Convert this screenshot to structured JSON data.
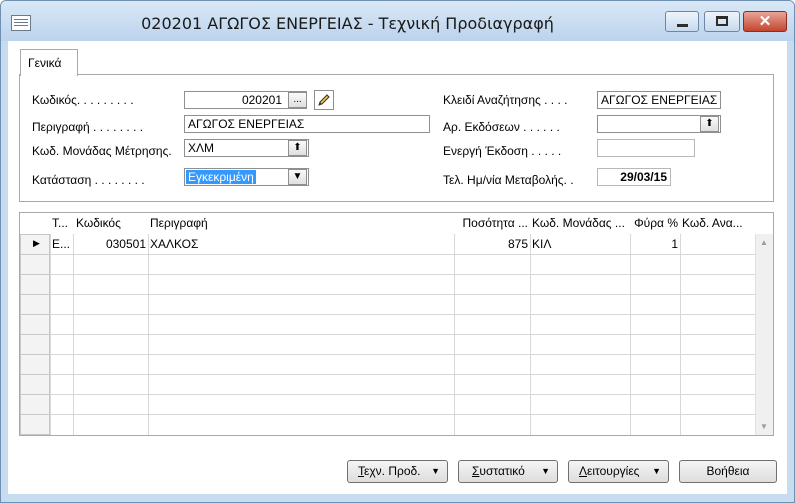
{
  "window": {
    "title": "020201 ΑΓΩΓΟΣ ΕΝΕΡΓΕΙΑΣ - Τεχνική Προδιαγραφή",
    "close_glyph": "✕"
  },
  "tabs": [
    {
      "label": "Γενικά",
      "active": true
    }
  ],
  "form": {
    "code_label": "Κωδικός. . . . . . . . .",
    "code_value": "020201",
    "description_label": "Περιγραφή . . . . . . . .",
    "description_value": "ΑΓΩΓΟΣ ΕΝΕΡΓΕΙΑΣ",
    "unit_label": "Κωδ. Μονάδας Μέτρησης.",
    "unit_value": "ΧΛΜ",
    "status_label": "Κατάσταση . . . . . . . .",
    "status_value": "Εγκεκριμένη",
    "search_key_label": "Κλειδί Αναζήτησης . . . .",
    "search_key_value": "ΑΓΩΓΟΣ ΕΝΕΡΓΕΙΑΣ",
    "versions_label": "Αρ. Εκδόσεων . . . . . .",
    "versions_value": "",
    "active_version_label": "Ενεργή Έκδοση . . . . .",
    "active_version_value": "",
    "last_modified_label": "Τελ. Ημ/νία Μεταβολής. .",
    "last_modified_value": "29/03/15"
  },
  "lines": {
    "columns": [
      "Τ...",
      "Κωδικός",
      "Περιγραφή",
      "Ποσότητα ...",
      "Κωδ. Μονάδας ...",
      "Φύρα %",
      "Κωδ. Ανα..."
    ],
    "rows": [
      {
        "type": "Ε...",
        "code": "030501",
        "description": "ΧΑΛΚΟΣ",
        "quantity": "875",
        "unit": "ΚΙΛ",
        "scrap": "1",
        "alt_code": ""
      }
    ]
  },
  "buttons": {
    "spec_prefix": "Τ",
    "spec_rest": "εχν. Προδ.",
    "component_prefix": "Σ",
    "component_rest": "υστατικό",
    "functions_prefix": "Λ",
    "functions_rest": "ειτουργίες",
    "help": "Βοήθεια"
  },
  "icons": {
    "lookup": "...",
    "dropdown_arrow": "▼",
    "up_arrow": "⬆",
    "pencil": "pencil-icon",
    "row_pointer": "▶",
    "scroll_up": "▲",
    "scroll_down": "▼"
  }
}
